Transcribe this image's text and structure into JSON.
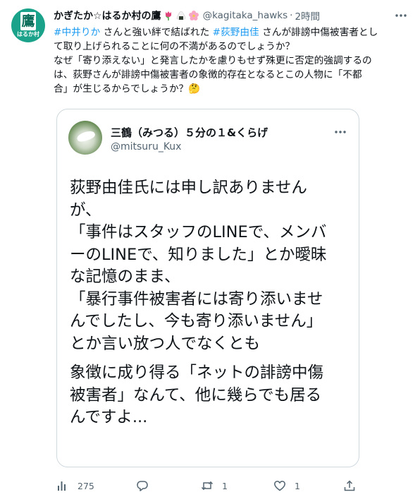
{
  "author": {
    "name": "かぎたか☆はるか村の鷹",
    "handle": "@kagitaka_hawks",
    "separator": "·",
    "time": "2時間",
    "avatar_glyph": "鷹",
    "avatar_caption": "はるか村"
  },
  "body_lines": [
    {
      "parts": [
        {
          "text": "#中井りか",
          "type": "hashtag"
        },
        {
          "text": " さんと強い絆で結ばれた ",
          "type": "text"
        },
        {
          "text": "#荻野由佳",
          "type": "hashtag"
        },
        {
          "text": " さんが誹謗中傷被害者とし",
          "type": "text"
        }
      ]
    },
    {
      "parts": [
        {
          "text": "て取り上げられることに何の不満があるのでしょうか？",
          "type": "text"
        }
      ]
    },
    {
      "parts": [
        {
          "text": "なぜ「寄り添えない」と発言したかを慮りもせず殊更に否定的強調するの",
          "type": "text"
        }
      ]
    },
    {
      "parts": [
        {
          "text": "は、荻野さんが誹謗中傷被害者の象徴的存在となるとこの人物に「不都",
          "type": "text"
        }
      ]
    },
    {
      "parts": [
        {
          "text": "合」が生じるからでしょうか？🤔",
          "type": "text"
        }
      ]
    }
  ],
  "quote": {
    "name": "三鶴（みつる）５分の１&くらげ",
    "handle": "@mitsuru_Kux",
    "paragraph1": [
      "荻野由佳氏には申し訳ありません",
      "が、",
      "「事件はスタッフのLINEで、メンバ",
      "ーのLINEで、知りました」とか曖昧",
      "な記憶のまま、",
      "「暴行事件被害者には寄り添いませ",
      "んでしたし、今も寄り添いません」",
      "とか言い放つ人でなくとも"
    ],
    "paragraph2": [
      "象徴に成り得る「ネットの誹謗中傷",
      "被害者」なんて、他に幾らでも居る",
      "んですよ..."
    ]
  },
  "actions": {
    "views": "275",
    "replies": "",
    "retweets": "1",
    "likes": "1"
  },
  "colors": {
    "hashtag": "#1d9bf0",
    "secondary_text": "#536471",
    "border": "#cfd9de"
  },
  "icons": [
    "more-icon",
    "views-icon",
    "reply-icon",
    "retweet-icon",
    "like-icon",
    "share-icon",
    "tulip-emoji-icon",
    "onigiri-emoji-icon",
    "blossom-emoji-icon"
  ]
}
